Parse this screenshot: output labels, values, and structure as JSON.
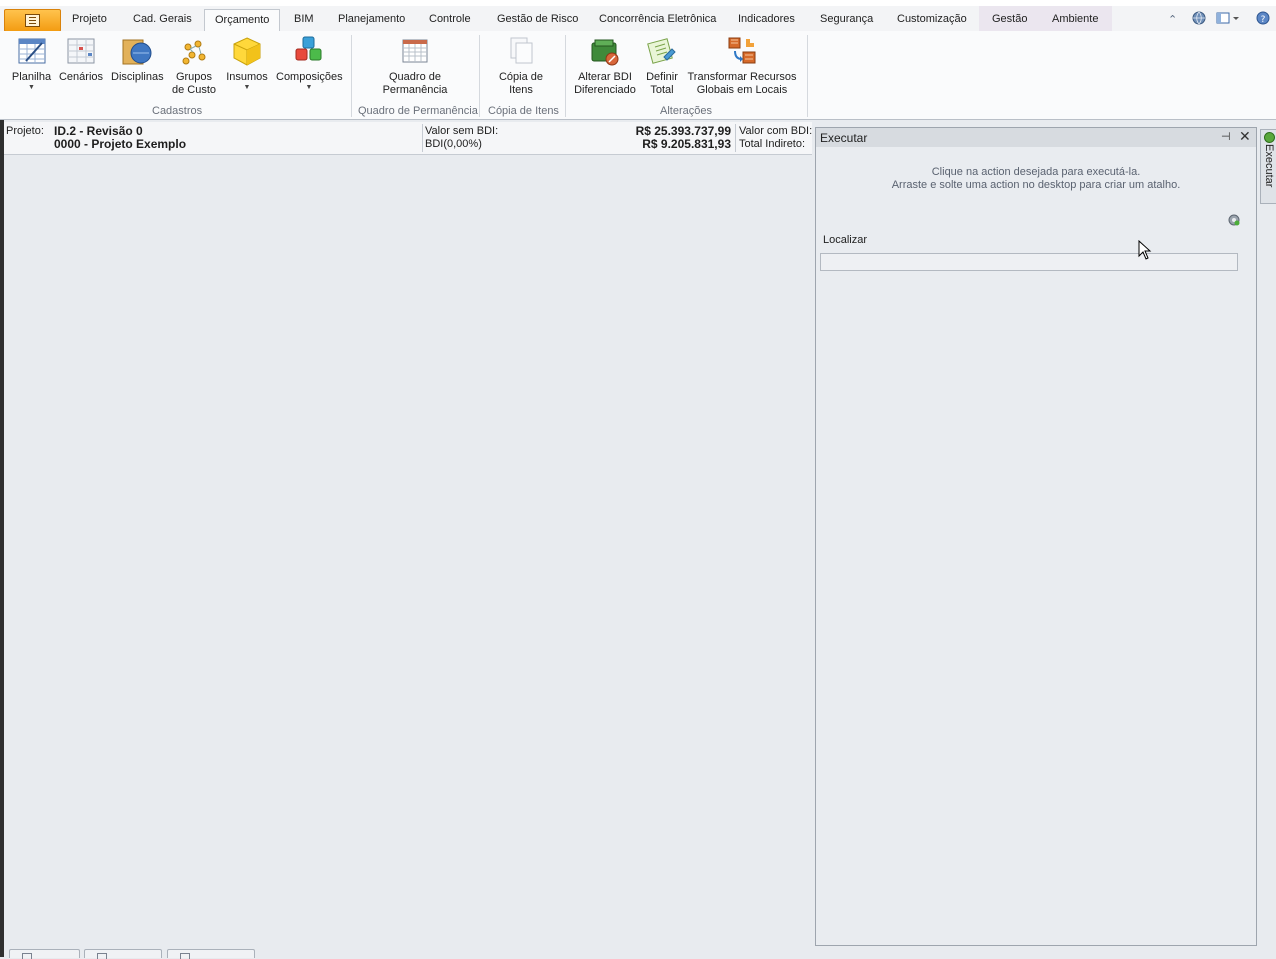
{
  "ribbon": {
    "tabs": [
      "Projeto",
      "Cad. Gerais",
      "Orçamento",
      "BIM",
      "Planejamento",
      "Controle",
      "Gestão de Risco",
      "Concorrência Eletrônica",
      "Indicadores",
      "Segurança",
      "Customização",
      "Gestão",
      "Ambiente"
    ],
    "active_tab": "Orçamento",
    "buttons": {
      "planilha": "Planilha",
      "cenarios": "Cenários",
      "disciplinas": "Disciplinas",
      "grupos_1": "Grupos",
      "grupos_2": "de Custo",
      "insumos": "Insumos",
      "composicoes": "Composições",
      "quadro_1": "Quadro de",
      "quadro_2": "Permanência",
      "copia_1": "Cópia de",
      "copia_2": "Itens",
      "alterar_1": "Alterar BDI",
      "alterar_2": "Diferenciado",
      "definir_1": "Definir",
      "definir_2": "Total",
      "transformar_1": "Transformar Recursos",
      "transformar_2": "Globais em Locais"
    },
    "groups": {
      "cadastros": "Cadastros",
      "quadro": "Quadro de Permanência",
      "copia": "Cópia de Itens",
      "alteracoes": "Alterações"
    }
  },
  "project_bar": {
    "label": "Projeto:",
    "id_line": "ID.2 - Revisão 0",
    "name_line": "0000 - Projeto Exemplo",
    "valor_sem_bdi_label": "Valor sem BDI:",
    "bdi_label": "BDI(0,00%)",
    "valor_sem_bdi": "R$ 25.393.737,99",
    "total_value": "R$ 9.205.831,93",
    "valor_com_bdi_label": "Valor com BDI:",
    "total_indireto_label": "Total Indireto:"
  },
  "exec_panel": {
    "title": "Executar",
    "hint_line1": "Clique na action desejada para executá-la.",
    "hint_line2": "Arraste e solte uma action no desktop para criar um atalho.",
    "find_label": "Localizar",
    "find_value": ""
  },
  "side_tab": {
    "label": "Executar"
  },
  "colors": {
    "accent": "#f39c12",
    "background": "#e8ebef",
    "ribbon": "#fafbfc"
  }
}
